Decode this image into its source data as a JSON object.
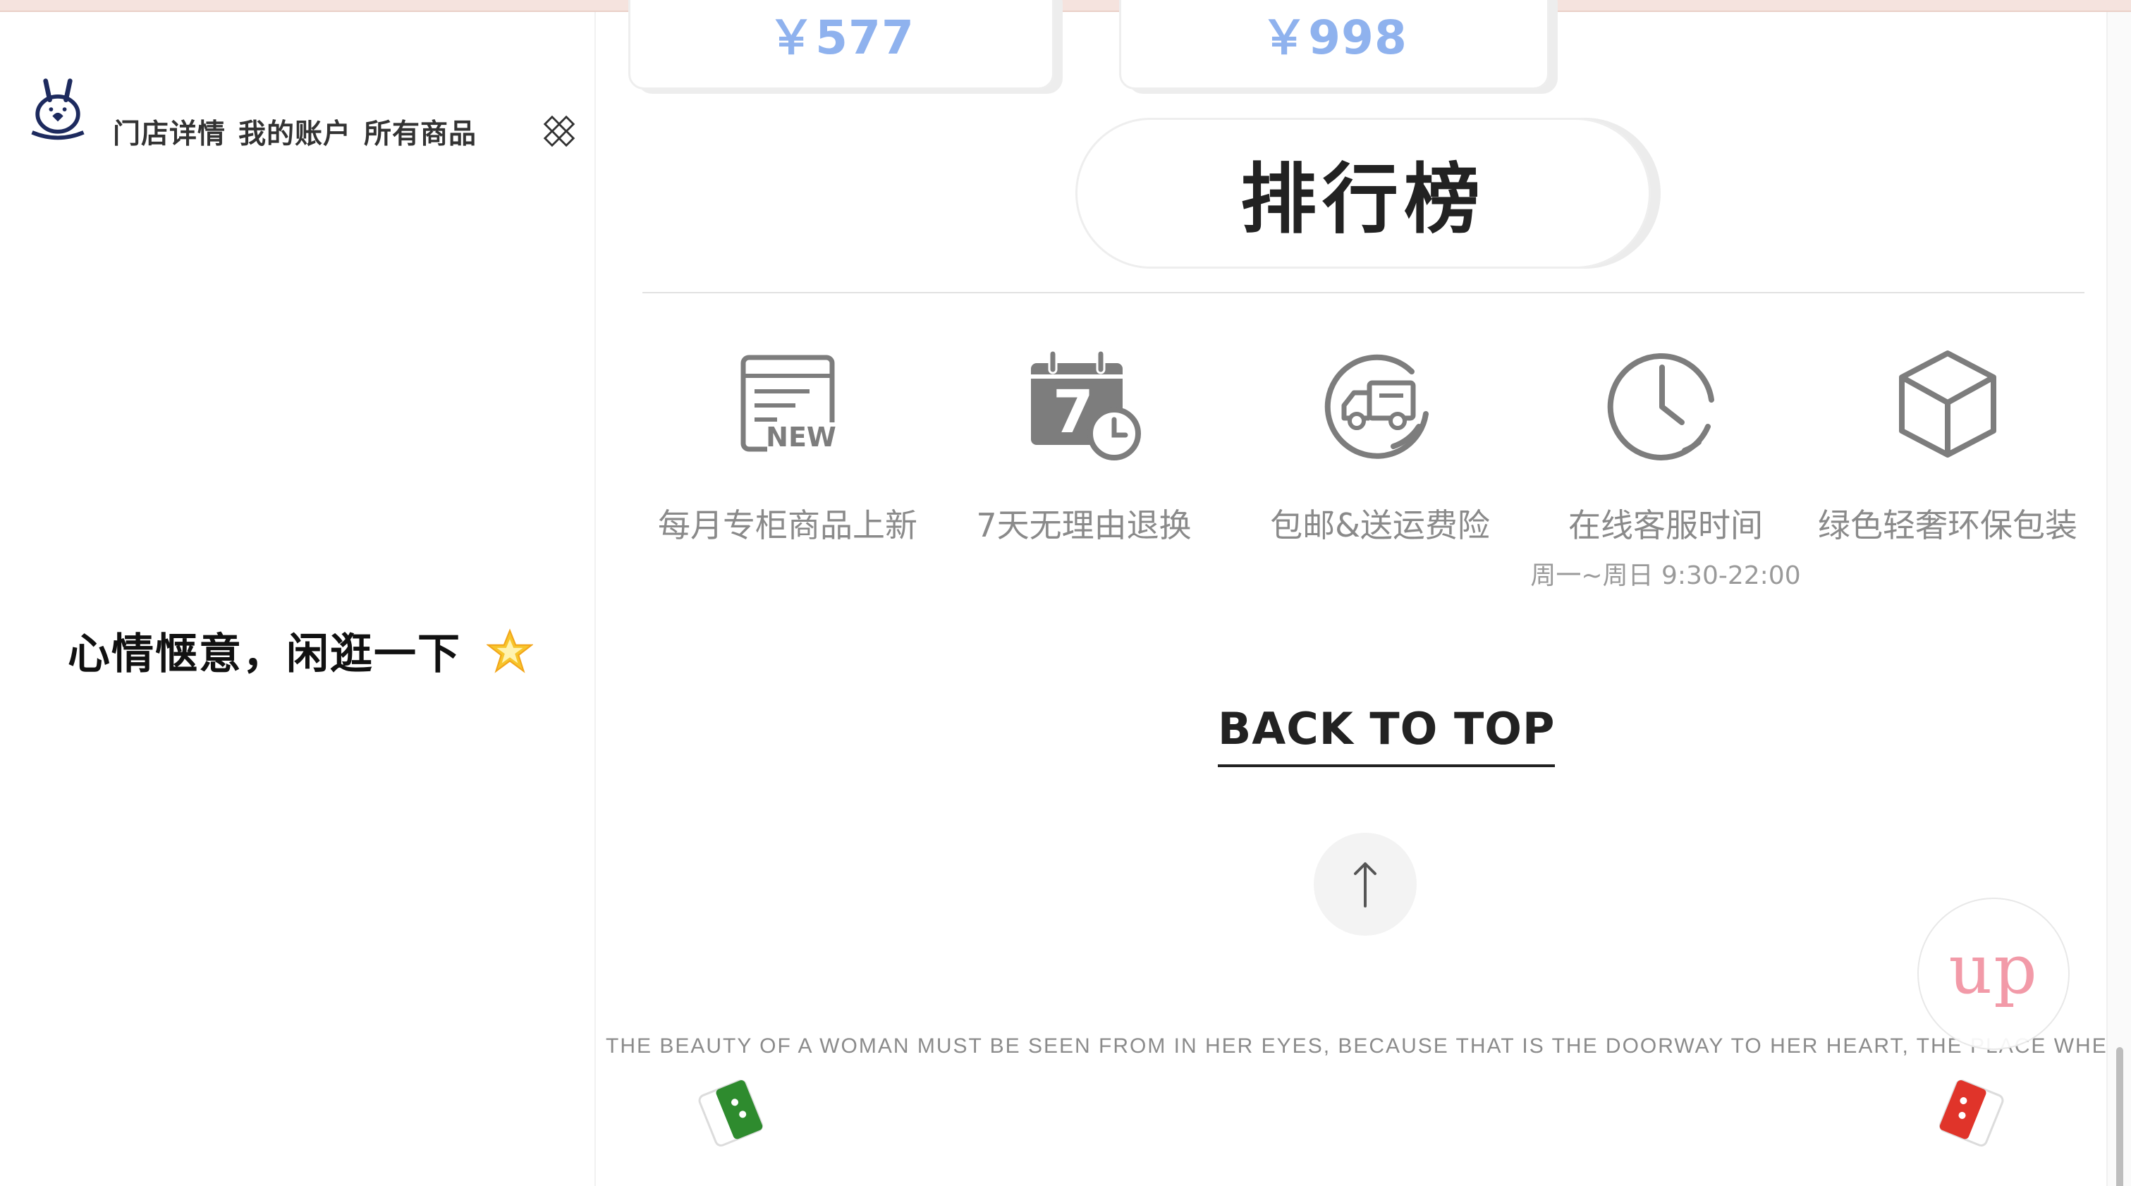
{
  "sidebar": {
    "nav": [
      {
        "label": "门店详情"
      },
      {
        "label": "我的账户"
      },
      {
        "label": "所有商品"
      }
    ],
    "mood_text": "心情惬意，闲逛一下",
    "icons": {
      "logo": "brand-bunny-logo",
      "menu": "puzzle-icon",
      "mood": "star-icon"
    }
  },
  "main": {
    "prices": [
      "￥577",
      "￥998"
    ],
    "ranking_title": "排行榜",
    "features": [
      {
        "label": "每月专柜商品上新",
        "icon": "new-document-icon",
        "icon_text": "NEW"
      },
      {
        "label": "7天无理由退换",
        "icon": "calendar-7-icon",
        "icon_text": "7"
      },
      {
        "label": "包邮&送运费险",
        "icon": "delivery-truck-icon"
      },
      {
        "label": "在线客服时间",
        "sub": "周一~周日 9:30-22:00",
        "icon": "clock-icon"
      },
      {
        "label": "绿色轻奢环保包装",
        "icon": "package-box-icon"
      }
    ],
    "back_to_top": "BACK TO TOP",
    "marquee": "THE BEAUTY OF A WOMAN MUST BE SEEN FROM IN HER EYES, BECAUSE THAT IS THE DOORWAY TO HER HEART, THE PLACE WHERE LOVE RESIDES",
    "up_badge": "up"
  },
  "colors": {
    "price": "#8fb2ee",
    "up_badge": "#f29aa8",
    "feature_icon": "#7d7d7d",
    "deco_green": "#2e8b2e",
    "deco_red": "#e0342a",
    "top_bar": "#f5e3de"
  }
}
